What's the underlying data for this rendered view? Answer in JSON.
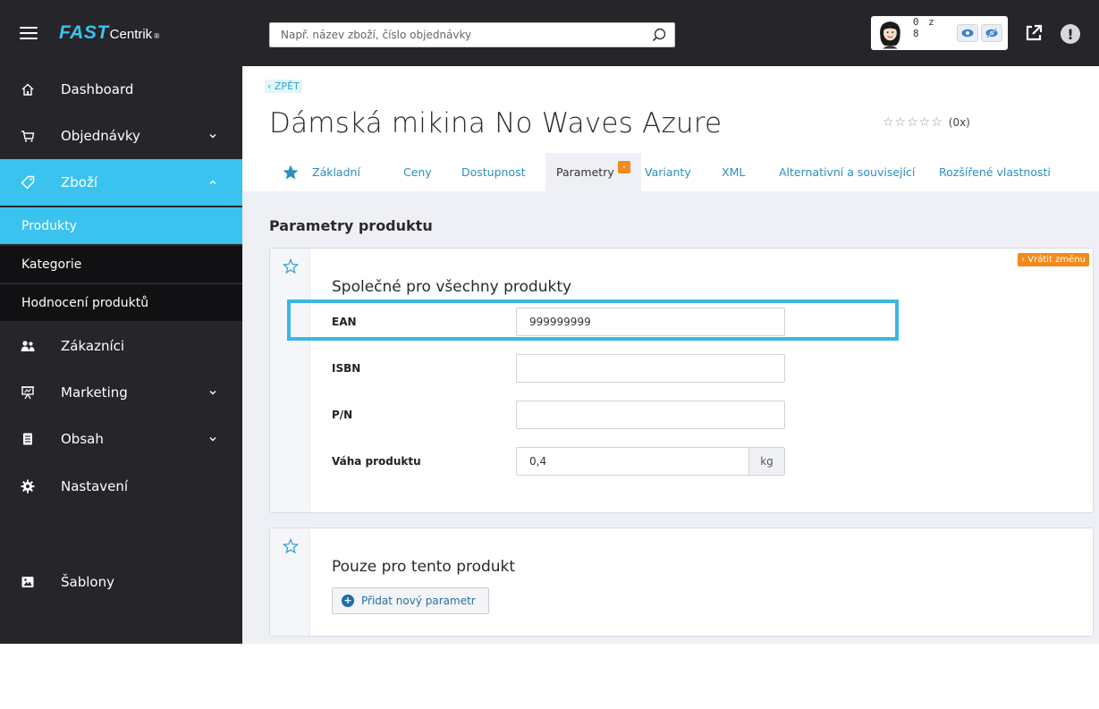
{
  "app": {
    "logo_main": "FAST",
    "logo_sub": "Centrik",
    "logo_reg": "®"
  },
  "header": {
    "search_placeholder": "Např. název zboží, číslo objednávky",
    "counter": "0 z 8",
    "warning_glyph": "!"
  },
  "sidebar": {
    "items": [
      {
        "label": "Dashboard",
        "icon": "home-icon"
      },
      {
        "label": "Objednávky",
        "icon": "cart-icon"
      },
      {
        "label": "Zboží",
        "icon": "tag-icon"
      },
      {
        "label": "Zákazníci",
        "icon": "users-icon"
      },
      {
        "label": "Marketing",
        "icon": "presentation-icon"
      },
      {
        "label": "Obsah",
        "icon": "document-icon"
      },
      {
        "label": "Nastavení",
        "icon": "gear-icon"
      },
      {
        "label": "Šablony",
        "icon": "image-icon"
      }
    ],
    "sub_items": [
      {
        "label": "Produkty"
      },
      {
        "label": "Kategorie"
      },
      {
        "label": "Hodnocení produktů"
      }
    ]
  },
  "page": {
    "back_label": "‹ ZPĚT",
    "title": "Dámská mikina No Waves Azure",
    "rating_stars": "☆☆☆☆☆",
    "rating_count": "(0x)",
    "tabs": [
      {
        "label": "Základní"
      },
      {
        "label": "Ceny"
      },
      {
        "label": "Dostupnost"
      },
      {
        "label": "Parametry",
        "badge": "‹"
      },
      {
        "label": "Varianty"
      },
      {
        "label": "XML"
      },
      {
        "label": "Alternativní a související"
      },
      {
        "label": "Rozšířené vlastnosti"
      }
    ],
    "section_title": "Parametry produktu",
    "common_card": {
      "heading": "Společné pro všechny produkty",
      "revert_label": "‹ Vrátit změnu",
      "fields": [
        {
          "label": "EAN",
          "value": "999999999"
        },
        {
          "label": "ISBN",
          "value": ""
        },
        {
          "label": "P/N",
          "value": ""
        },
        {
          "label": "Váha produktu",
          "value": "0,4",
          "unit": "kg"
        }
      ]
    },
    "product_card": {
      "heading": "Pouze pro tento produkt",
      "add_button": "Přidat nový parametr",
      "add_glyph": "+"
    }
  },
  "colors": {
    "accent": "#3ac3ee",
    "dark": "#25252a",
    "orange": "#f28a1c"
  }
}
